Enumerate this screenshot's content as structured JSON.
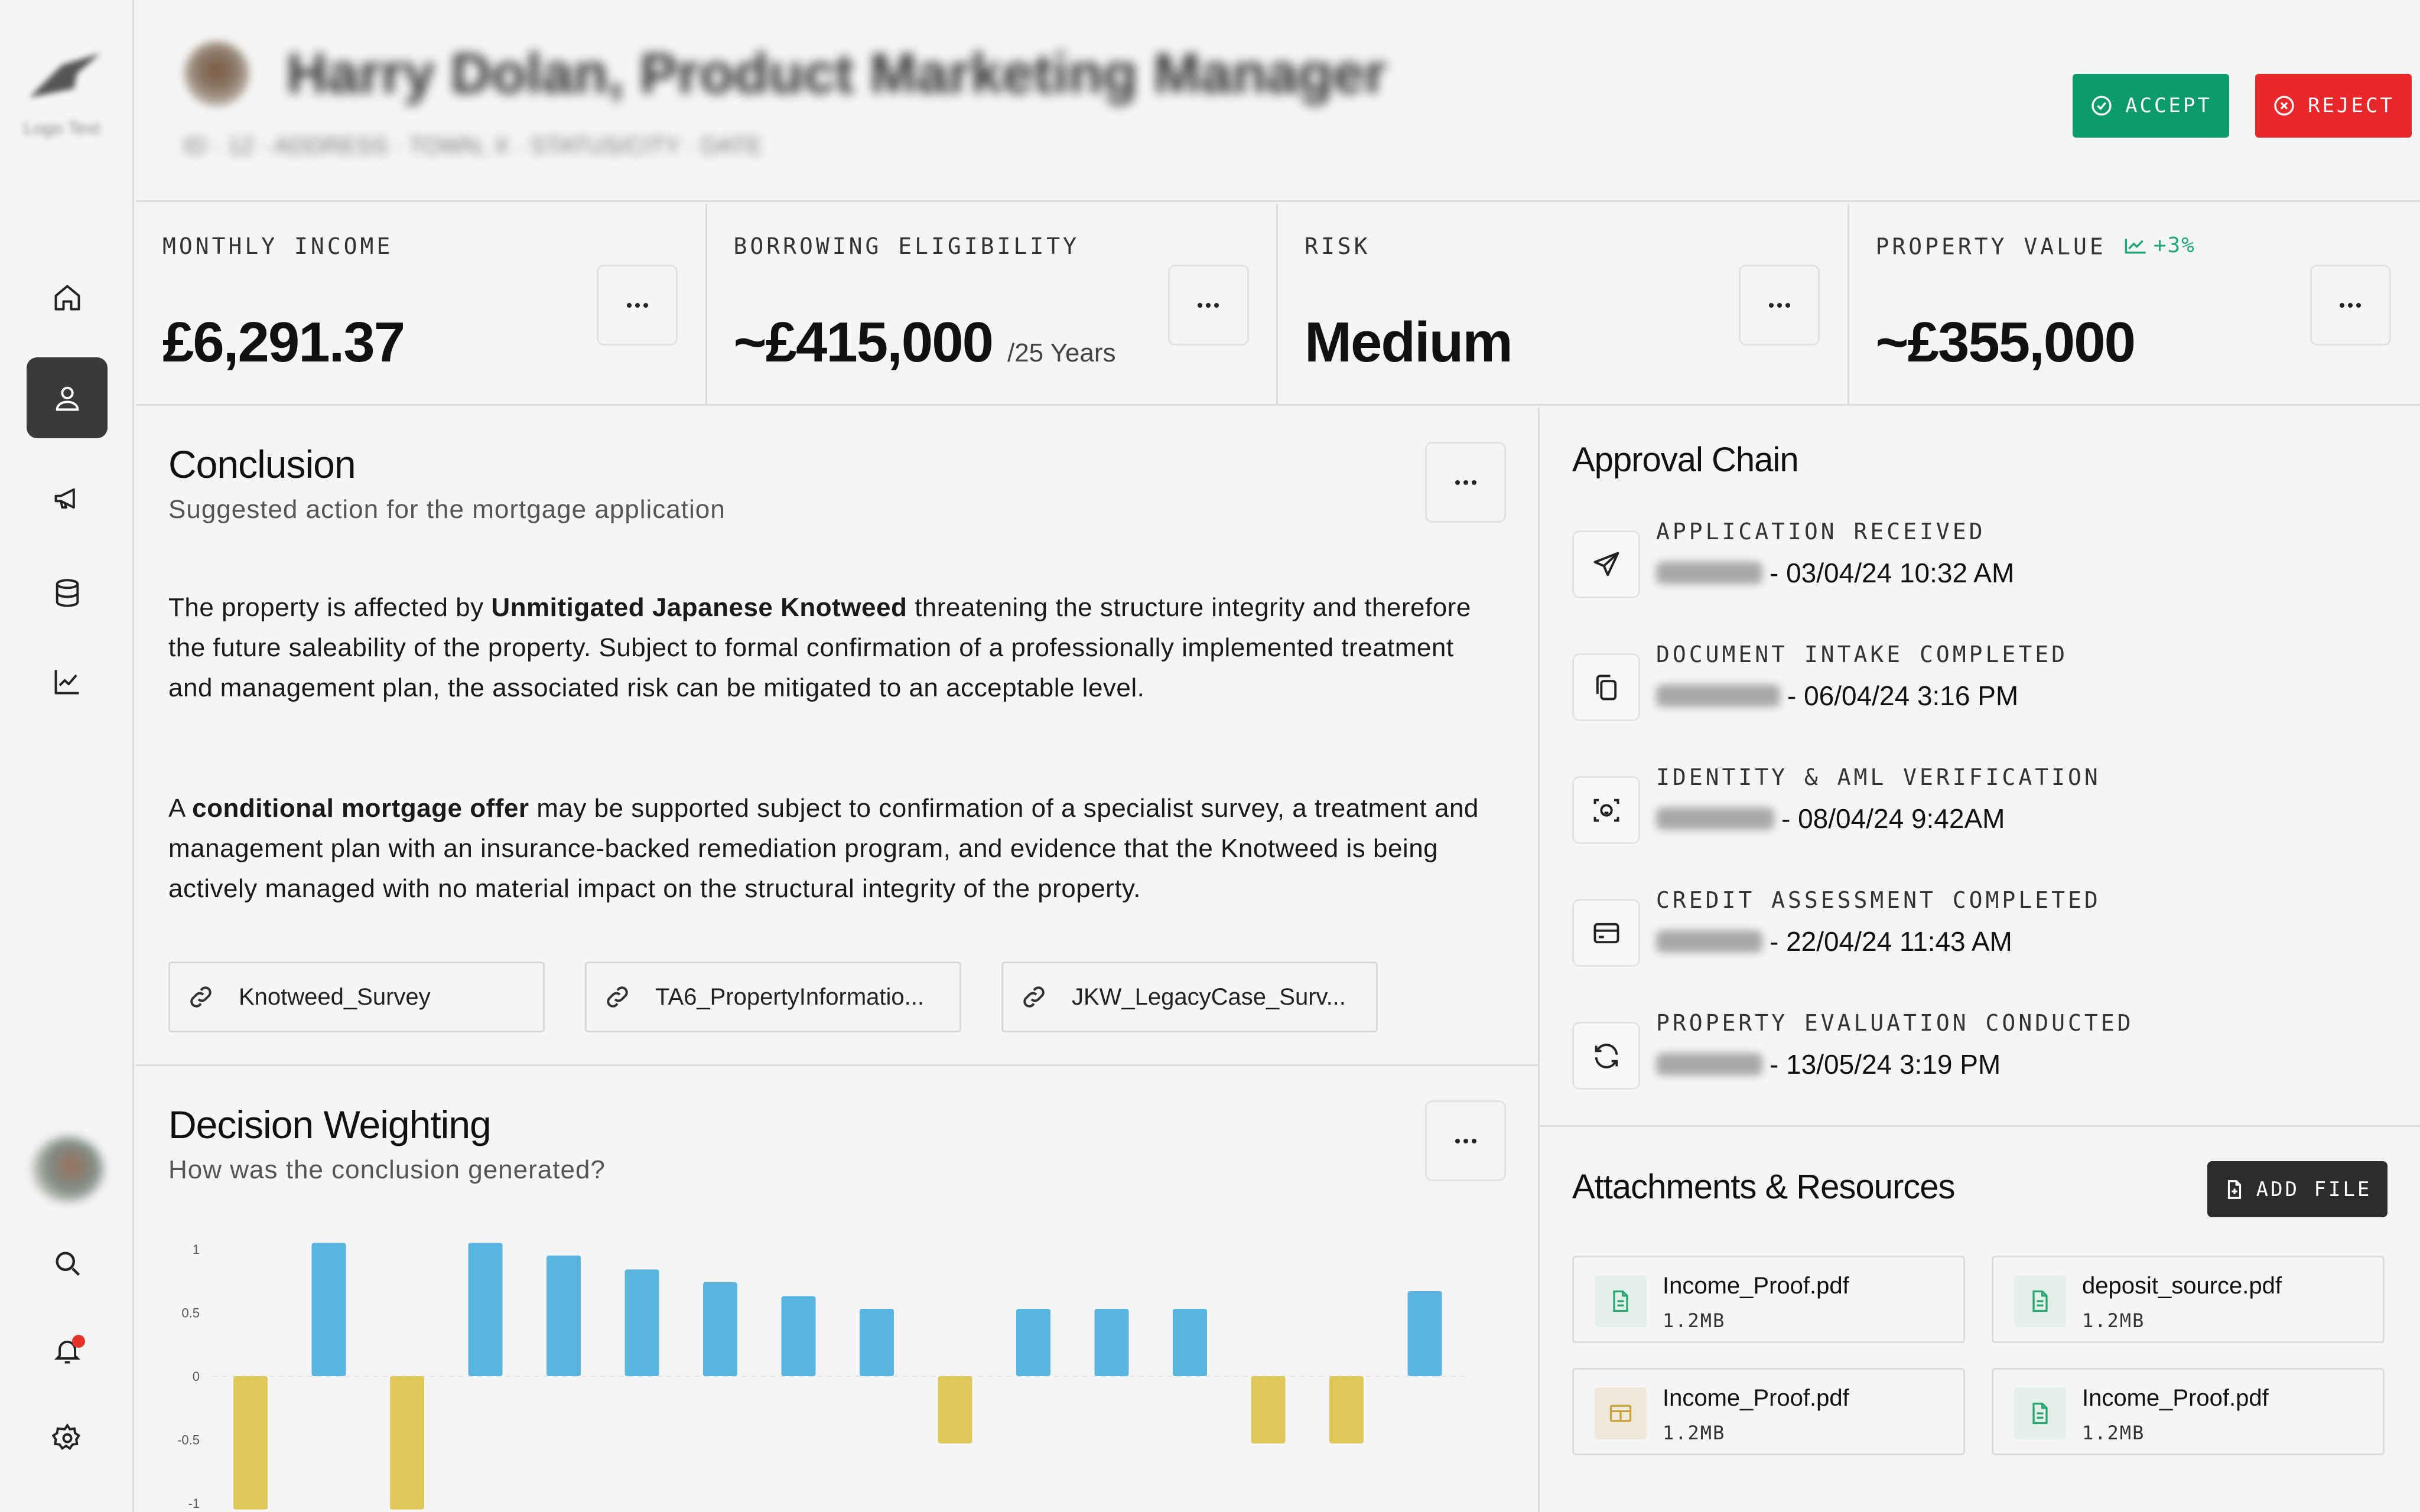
{
  "header": {
    "title": "Harry Dolan, Product Marketing Manager",
    "subtitle": "ID · 12   ·   ADDRESS · TOWN, X   ·   STATUS/CITY · DATE",
    "accept_label": "ACCEPT",
    "reject_label": "REJECT",
    "colors": {
      "accept": "#0d9b6c",
      "reject": "#e8272a"
    }
  },
  "sidebar": {
    "logo_text": "Logo Text",
    "items": [
      {
        "icon": "home-icon",
        "active": false
      },
      {
        "icon": "user-icon",
        "active": true
      },
      {
        "icon": "megaphone-icon",
        "active": false
      },
      {
        "icon": "database-icon",
        "active": false
      },
      {
        "icon": "chart-line-icon",
        "active": false
      }
    ],
    "bottom": [
      "search-icon",
      "bell-icon",
      "settings-icon"
    ]
  },
  "metrics": [
    {
      "label": "MONTHLY INCOME",
      "value": "£6,291.37"
    },
    {
      "label": "BORROWING ELIGIBILITY",
      "value": "~£415,000",
      "suffix": "/25 Years"
    },
    {
      "label": "RISK",
      "value": "Medium"
    },
    {
      "label": "PROPERTY VALUE",
      "value": "~£355,000",
      "change": "+3%"
    }
  ],
  "conclusion": {
    "title": "Conclusion",
    "subtitle": "Suggested action for the mortgage application",
    "p1_pre": "The property is affected by ",
    "p1_bold": "Unmitigated Japanese Knotweed",
    "p1_post": " threatening the structure integrity and therefore the future saleability of the property. Subject to formal confirmation of a professionally implemented treatment and management plan, the associated risk can be mitigated to an acceptable level.",
    "p2_pre": "A ",
    "p2_bold": "conditional mortgage offer",
    "p2_post": " may be supported subject to confirmation of a specialist survey, a treatment and management plan with an insurance-backed remediation program, and evidence that the Knotweed is being actively managed with no material impact on the structural integrity of the property.",
    "links": [
      "Knotweed_Survey",
      "TA6_PropertyInformatio...",
      "JKW_LegacyCase_Surv..."
    ]
  },
  "decision": {
    "title": "Decision Weighting",
    "subtitle": "How was the conclusion generated?"
  },
  "chart_data": {
    "type": "bar",
    "ylim": [
      -1,
      1
    ],
    "yticks": [
      "1",
      "0.5",
      "0",
      "-0.5",
      "-1"
    ],
    "values": [
      -1.05,
      1.05,
      -1.05,
      1.05,
      0.95,
      0.84,
      0.74,
      0.63,
      0.53,
      -0.53,
      0.53,
      0.53,
      0.53,
      -0.53,
      -0.53,
      0.67
    ],
    "colors": {
      "positive": "#5ab4e0",
      "negative": "#e0c75a"
    }
  },
  "approval": {
    "title": "Approval Chain",
    "steps": [
      {
        "icon": "send-icon",
        "label": "APPLICATION RECEIVED",
        "datetime": "- 03/04/24 10:32 AM"
      },
      {
        "icon": "copy-icon",
        "label": "DOCUMENT INTAKE COMPLETED",
        "datetime": "- 06/04/24 3:16 PM"
      },
      {
        "icon": "scan-face-icon",
        "label": "IDENTITY & AML VERIFICATION",
        "datetime": "- 08/04/24 9:42AM"
      },
      {
        "icon": "credit-card-icon",
        "label": "CREDIT ASSESSMENT COMPLETED",
        "datetime": "- 22/04/24 11:43 AM"
      },
      {
        "icon": "refresh-icon",
        "label": "PROPERTY EVALUATION CONDUCTED",
        "datetime": "- 13/05/24 3:19 PM"
      }
    ]
  },
  "attachments": {
    "title": "Attachments & Resources",
    "add_label": "ADD FILE",
    "files": [
      {
        "name": "Income_Proof.pdf",
        "size": "1.2MB",
        "icon": "file-text-icon"
      },
      {
        "name": "deposit_source.pdf",
        "size": "1.2MB",
        "icon": "file-text-icon"
      },
      {
        "name": "Income_Proof.pdf",
        "size": "1.2MB",
        "icon": "table-icon"
      },
      {
        "name": "Income_Proof.pdf",
        "size": "1.2MB",
        "icon": "file-text-icon"
      }
    ]
  }
}
